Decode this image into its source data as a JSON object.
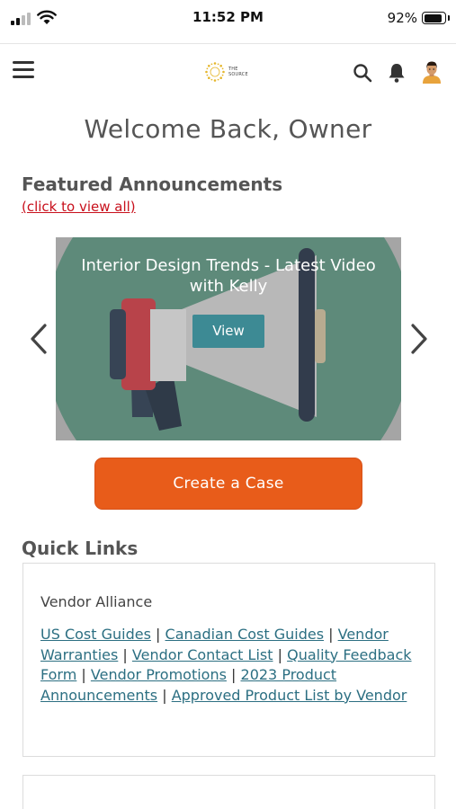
{
  "status_bar": {
    "time": "11:52 PM",
    "battery_percent": "92%",
    "battery_level": 0.92
  },
  "header": {
    "menu_icon": "hamburger-menu-icon",
    "logo_text_line1": "THE",
    "logo_text_line2": "SOURCE",
    "search_icon": "search-icon",
    "bell_icon": "bell-icon",
    "avatar_icon": "user-avatar"
  },
  "welcome": "Welcome Back,  Owner",
  "featured": {
    "title": "Featured Announcements",
    "view_all": "(click to view all)",
    "slide": {
      "title": "Interior Design Trends - Latest Video with Kelly",
      "button": "View",
      "image_icon": "megaphone-icon"
    },
    "prev_icon": "chevron-left-icon",
    "next_icon": "chevron-right-icon"
  },
  "create_case": "Create a Case",
  "quick_links": {
    "title": "Quick Links",
    "card_heading": "Vendor Alliance",
    "links": [
      "US Cost Guides",
      "Canadian Cost Guides",
      "Vendor Warranties",
      "Vendor Contact List",
      "Quality Feedback Form",
      "Vendor Promotions",
      "2023 Product Announcements",
      "Approved Product List by Vendor"
    ],
    "separator": "|"
  },
  "colors": {
    "accent_orange": "#e85c1a",
    "link_teal": "#2c6f82",
    "view_button": "#3d8a94",
    "alert_red": "#c8101c",
    "slide_circle": "#5e8a7a"
  }
}
